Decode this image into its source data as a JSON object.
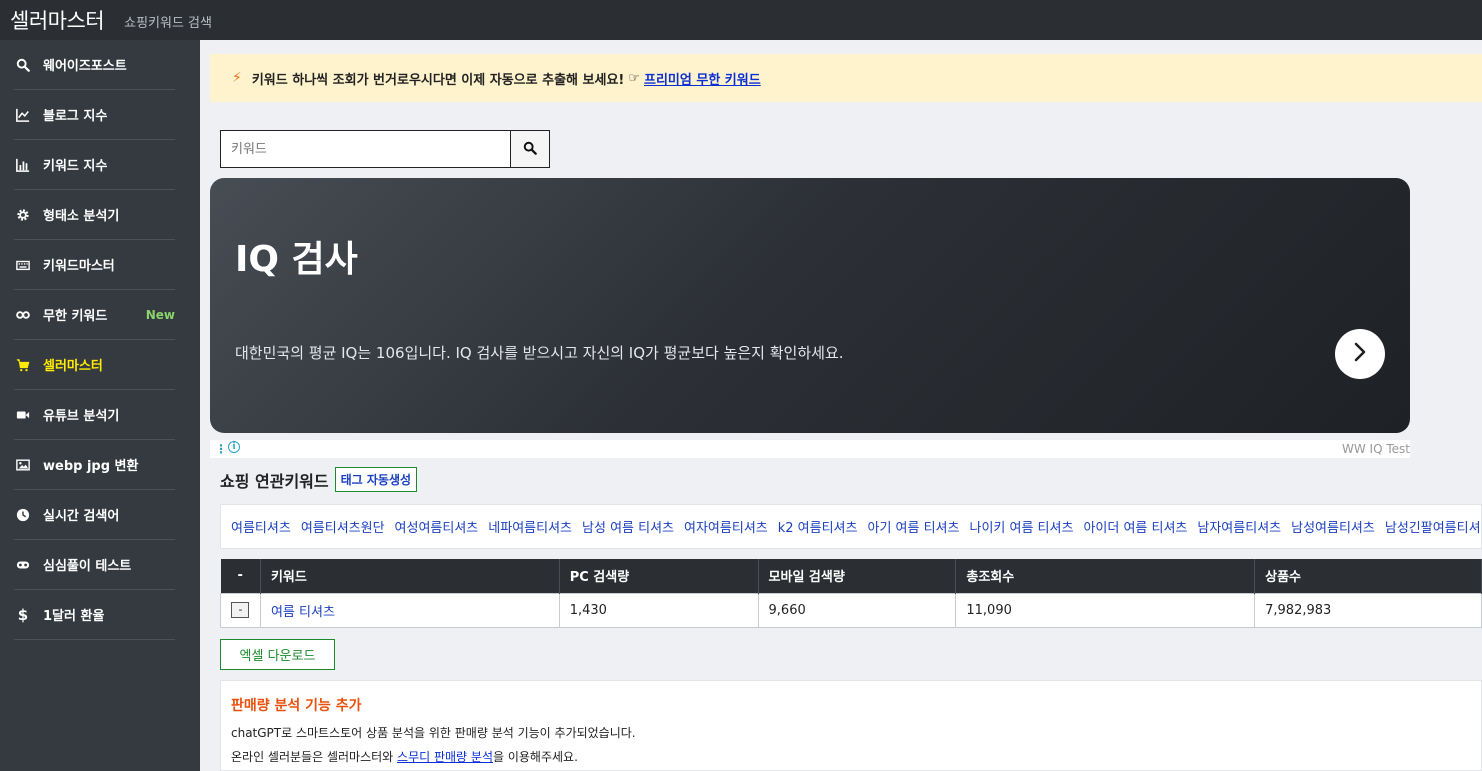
{
  "topbar": {
    "brand": "셀러마스터",
    "subtitle": "쇼핑키워드 검색"
  },
  "sidebar": {
    "items": [
      {
        "label": "웨어이즈포스트",
        "icon": "search-icon"
      },
      {
        "label": "블로그 지수",
        "icon": "line-chart-icon"
      },
      {
        "label": "키워드 지수",
        "icon": "bar-chart-icon"
      },
      {
        "label": "형태소 분석기",
        "icon": "gear-icon"
      },
      {
        "label": "키워드마스터",
        "icon": "keyboard-icon"
      },
      {
        "label": "무한 키워드",
        "icon": "infinity-icon",
        "badge": "New"
      },
      {
        "label": "셀러마스터",
        "icon": "cart-icon",
        "active": true
      },
      {
        "label": "유튜브 분석기",
        "icon": "video-camera-icon"
      },
      {
        "label": "webp jpg 변환",
        "icon": "image-icon"
      },
      {
        "label": "실시간 검색어",
        "icon": "clock-icon"
      },
      {
        "label": "심심풀이 테스트",
        "icon": "gamepad-icon"
      },
      {
        "label": "1달러 환율",
        "icon": "dollar-icon"
      }
    ],
    "badge_color": "#8bd36b",
    "active_color": "#ffec00"
  },
  "notice": {
    "text": "키워드 하나씩 조회가 번거로우시다면 이제 자동으로 추출해 보세요!",
    "hand": "☞",
    "link": "프리미엄 무한 키워드"
  },
  "search": {
    "placeholder": "키워드",
    "value": ""
  },
  "ad": {
    "title": "IQ 검사",
    "description": "대한민국의 평균 IQ는 106입니다. IQ 검사를 받으시고 자신의 IQ가 평균보다 높은지 확인하세요.",
    "source": "WW IQ Test"
  },
  "related": {
    "title": "쇼핑 연관키워드",
    "tag_button": "태그 자동생성",
    "keywords": [
      "여름티셔츠",
      "여름티셔츠원단",
      "여성여름티셔츠",
      "네파여름티셔츠",
      "남성 여름 티셔츠",
      "여자여름티셔츠",
      "k2 여름티셔츠",
      "아기 여름 티셔츠",
      "나이키 여름 티셔츠",
      "아이더 여름 티셔츠",
      "남자여름티셔츠",
      "남성여름티셔츠",
      "남성긴팔여름티셔츠"
    ]
  },
  "table": {
    "headers": [
      "-",
      "키워드",
      "PC 검색량",
      "모바일 검색량",
      "총조회수",
      "상품수"
    ],
    "rows": [
      {
        "btn": "-",
        "keyword": "여름 티셔츠",
        "pc": "1,430",
        "mobile": "9,660",
        "total": "11,090",
        "products": "7,982,983"
      }
    ]
  },
  "excel_button": "엑셀 다운로드",
  "info": {
    "title": "판매량 분석 기능 추가",
    "line1": "chatGPT로 스마트스토어 상품 분석을 위한 판매량 분석 기능이 추가되었습니다.",
    "line2_before": "온라인 셀러분들은 셀러마스터와",
    "line2_link": "스무디 판매량 분석",
    "line2_after": "을 이용해주세요."
  }
}
